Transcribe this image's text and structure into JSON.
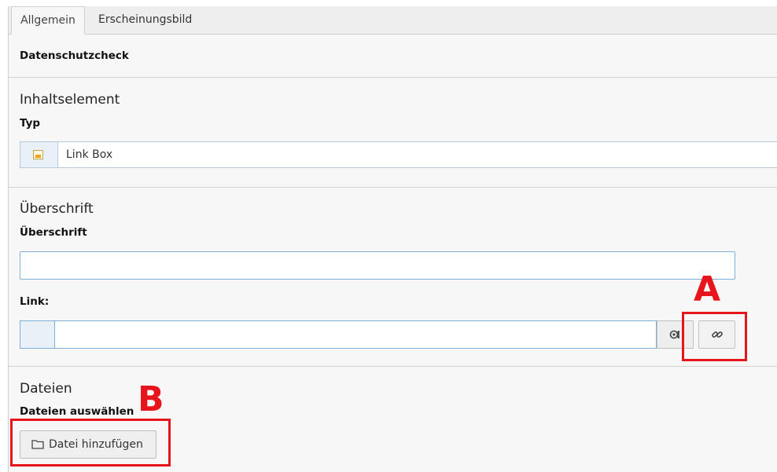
{
  "tabs": [
    {
      "label": "Allgemein",
      "active": true
    },
    {
      "label": "Erscheinungsbild",
      "active": false
    }
  ],
  "privacy": {
    "label": "Datenschutzcheck"
  },
  "content_element": {
    "section_title": "Inhaltselement",
    "type_label": "Typ",
    "type_value": "Link Box",
    "type_icon": "content-element-icon"
  },
  "heading": {
    "section_title": "Überschrift",
    "field_label": "Überschrift",
    "field_value": "",
    "link_label": "Link:",
    "link_value": "",
    "browse_icon": "link-browser-icon",
    "link_icon": "chain-link-icon"
  },
  "files": {
    "section_title": "Dateien",
    "field_label": "Dateien auswählen",
    "add_button_label": "Datei hinzufügen",
    "add_button_icon": "folder-icon"
  },
  "annotations": [
    {
      "letter": "A",
      "target": "link-button"
    },
    {
      "letter": "B",
      "target": "add-file-button"
    }
  ],
  "colors": {
    "annotation": "#e8141b",
    "input_border": "#80b0d9",
    "icon_cell": "#e9f0f7"
  }
}
